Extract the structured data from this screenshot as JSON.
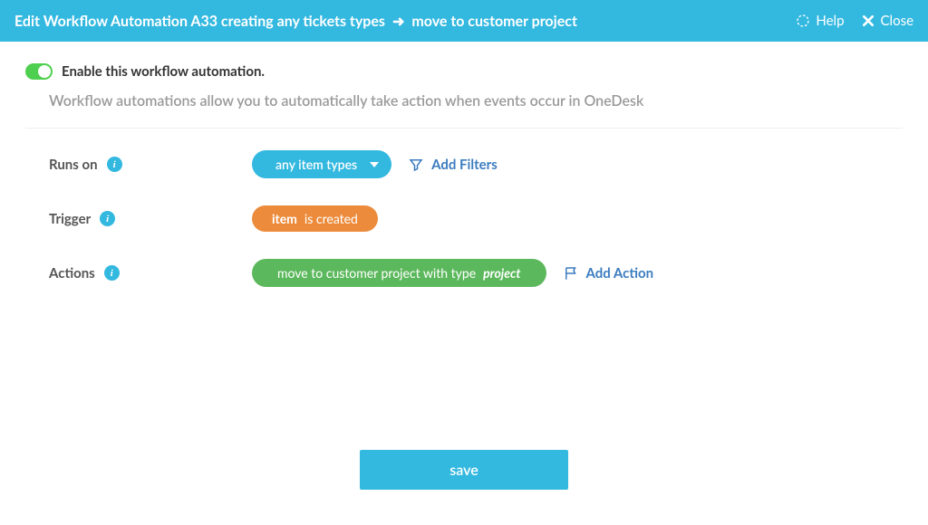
{
  "header": {
    "title_prefix": "Edit Workflow Automation A33 creating any tickets types",
    "title_arrow": "➜",
    "title_suffix": "move to customer project",
    "help_label": "Help",
    "close_label": "Close"
  },
  "enable": {
    "label": "Enable this workflow automation."
  },
  "description": "Workflow automations allow you to automatically take action when events occur in OneDesk",
  "rows": {
    "runs_on": {
      "label": "Runs on",
      "pill": "any item types",
      "add_link": "Add Filters"
    },
    "trigger": {
      "label": "Trigger",
      "pill_strong": "item",
      "pill_rest": "is created"
    },
    "actions": {
      "label": "Actions",
      "pill_prefix": "move to customer project with type",
      "pill_em": "project",
      "add_link": "Add Action"
    }
  },
  "save": {
    "label": "save"
  }
}
